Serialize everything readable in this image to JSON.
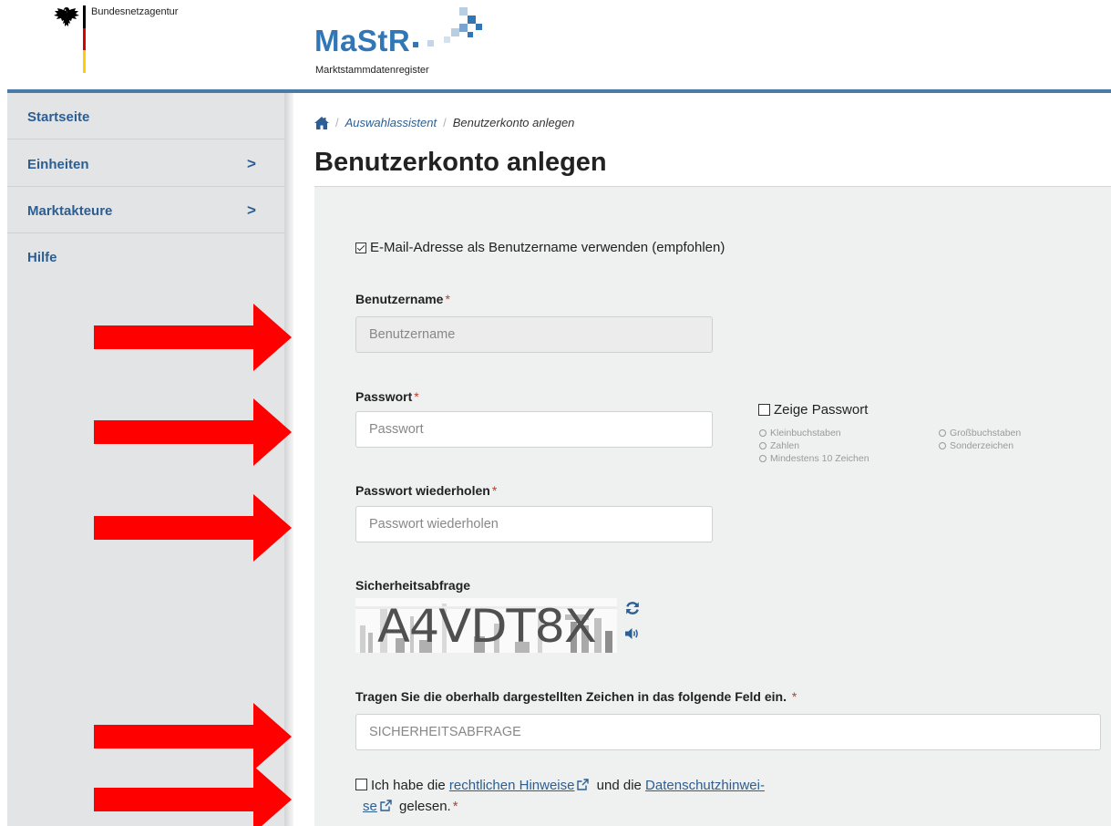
{
  "header": {
    "agency_name": "Bundesnetzagentur",
    "logo_title": "MaStR",
    "logo_subtitle": "Marktstammdatenregister",
    "colors": {
      "brand_blue": "#3277b5",
      "flag_black": "#000000",
      "flag_red": "#dd0000",
      "flag_gold": "#ffce00"
    }
  },
  "sidebar": {
    "items": [
      {
        "label": "Startseite",
        "has_submenu": false
      },
      {
        "label": "Einheiten",
        "has_submenu": true,
        "chevron": ">"
      },
      {
        "label": "Marktakteure",
        "has_submenu": true,
        "chevron": ">"
      },
      {
        "label": "Hilfe",
        "has_submenu": false
      }
    ]
  },
  "breadcrumb": {
    "home_icon": "home-icon",
    "separator": "/",
    "items": [
      "Auswahlassistent",
      "Benutzerkonto anlegen"
    ]
  },
  "page_title": "Benutzerkonto anlegen",
  "form": {
    "use_email_checkbox": {
      "label": "E-Mail-Adresse als Benutzername verwenden (empfohlen)",
      "checked": true
    },
    "required_mark": "*",
    "username": {
      "label": "Benutzername",
      "placeholder": "Benutzername",
      "disabled": true
    },
    "password": {
      "label": "Passwort",
      "placeholder": "Passwort"
    },
    "show_password": {
      "label": "Zeige Passwort",
      "checked": false
    },
    "password_rules": {
      "left": [
        "Kleinbuchstaben",
        "Zahlen",
        "Mindestens 10 Zeichen"
      ],
      "right": [
        "Großbuchstaben",
        "Sonderzeichen"
      ]
    },
    "password_repeat": {
      "label": "Passwort wiederholen",
      "placeholder": "Passwort wiederholen"
    },
    "captcha": {
      "label": "Sicherheitsabfrage",
      "text": "A4VDT8X",
      "refresh_icon": "refresh-icon",
      "audio_icon": "speaker-icon"
    },
    "captcha_input": {
      "label": "Tragen Sie die oberhalb dargestellten Zeichen in das folgende Feld ein.",
      "placeholder": "SICHERHEITSABFRAGE"
    },
    "terms": {
      "prefix": "Ich habe die",
      "link1": "rechtlichen Hinweise",
      "middle": "und die",
      "link2_part1": "Datenschutzhinwei-",
      "link2_part2": "se",
      "suffix": "gelesen.",
      "checked": false
    }
  },
  "annotations": {
    "arrow_color": "#ff0000",
    "arrow_count": 5
  }
}
